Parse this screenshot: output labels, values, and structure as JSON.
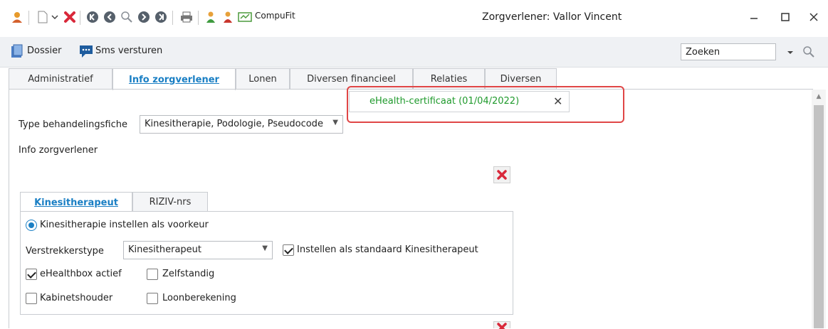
{
  "window": {
    "title": "Zorgverlener: Vallor Vincent",
    "compufit_label": "CompuFit"
  },
  "toolbar2": {
    "dossier_label": "Dossier",
    "sms_label": "Sms versturen",
    "search_value": "Zoeken"
  },
  "tabs": [
    {
      "label": "Administratief"
    },
    {
      "label": "Info zorgverlener"
    },
    {
      "label": "Lonen"
    },
    {
      "label": "Diversen financieel"
    },
    {
      "label": "Relaties"
    },
    {
      "label": "Diversen"
    }
  ],
  "ehealth": {
    "text": "eHealth-certificaat (01/04/2022)",
    "close": "✕"
  },
  "form": {
    "type_label": "Type behandelingsfiche",
    "type_value": "Kinesitherapie, Podologie, Pseudocode",
    "info_label": "Info zorgverlener"
  },
  "subtabs": [
    {
      "label": "Kinesitherapeut"
    },
    {
      "label": "RIZIV-nrs"
    }
  ],
  "kine": {
    "radio_label": "Kinesitherapie instellen als voorkeur",
    "verstrekkerstype_label": "Verstrekkerstype",
    "verstrekkerstype_value": "Kinesitherapeut",
    "standaard_label": "Instellen als standaard Kinesitherapeut",
    "ehealthbox_label": "eHealthbox actief",
    "zelfstandig_label": "Zelfstandig",
    "kabinetshouder_label": "Kabinetshouder",
    "loonberekening_label": "Loonberekening",
    "radio_checked": true,
    "standaard_checked": true,
    "ehealthbox_checked": true,
    "zelfstandig_checked": false,
    "kabinetshouder_checked": false,
    "loonberekening_checked": false
  },
  "colors": {
    "accent": "#1a7fc4",
    "ehealth_green": "#1f9a2c",
    "highlight_red": "#e04646"
  }
}
